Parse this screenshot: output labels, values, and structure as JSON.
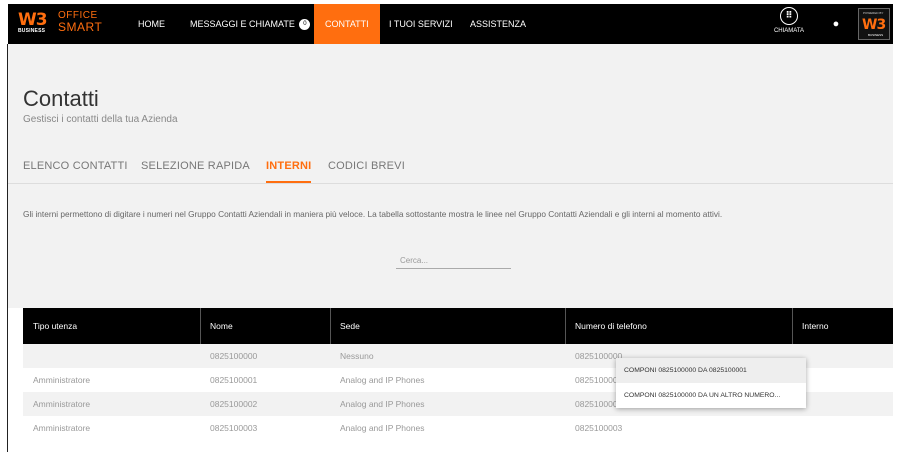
{
  "navbar": {
    "logo": {
      "mark": "W3",
      "business": "BUSINESS",
      "office": "OFFICE",
      "smart": "SMART"
    },
    "items": [
      {
        "label": "HOME"
      },
      {
        "label": "MESSAGGI E CHIAMATE",
        "badge": "0"
      },
      {
        "label": "CONTATTI"
      },
      {
        "label": "I TUOI SERVIZI"
      },
      {
        "label": "ASSISTENZA"
      }
    ],
    "call_label": "CHIAMATA",
    "call_icon": "dialpad-icon",
    "user_icon": "user-icon",
    "powered_by": {
      "top": "POWERED BY",
      "mark": "W3",
      "bottom": "BUSINESS"
    },
    "accent_color": "#ff6e0f"
  },
  "page": {
    "title": "Contatti",
    "subtitle": "Gestisci i contatti della tua Azienda"
  },
  "tabs": [
    {
      "label": "ELENCO CONTATTI"
    },
    {
      "label": "SELEZIONE RAPIDA"
    },
    {
      "label": "INTERNI"
    },
    {
      "label": "CODICI BREVI"
    }
  ],
  "description": "Gli interni permettono di digitare i numeri nel Gruppo Contatti Aziendali in maniera più veloce. La tabella sottostante mostra le linee nel Gruppo Contatti Aziendali e gli interni al momento attivi.",
  "search": {
    "placeholder": "Cerca..."
  },
  "table": {
    "headers": [
      "Tipo utenza",
      "Nome",
      "Sede",
      "Numero di telefono",
      "Interno"
    ],
    "rows": [
      [
        "",
        "0825100000",
        "Nessuno",
        "0825100000",
        ""
      ],
      [
        "Amministratore",
        "0825100001",
        "Analog and IP Phones",
        "0825100001",
        ""
      ],
      [
        "Amministratore",
        "0825100002",
        "Analog and IP Phones",
        "0825100002",
        ""
      ],
      [
        "Amministratore",
        "0825100003",
        "Analog and IP Phones",
        "0825100003",
        ""
      ]
    ]
  },
  "context_menu": {
    "items": [
      {
        "label": "COMPONI 0825100000 DA 0825100001"
      },
      {
        "label": "COMPONI 0825100000 DA UN ALTRO NUMERO..."
      }
    ]
  }
}
